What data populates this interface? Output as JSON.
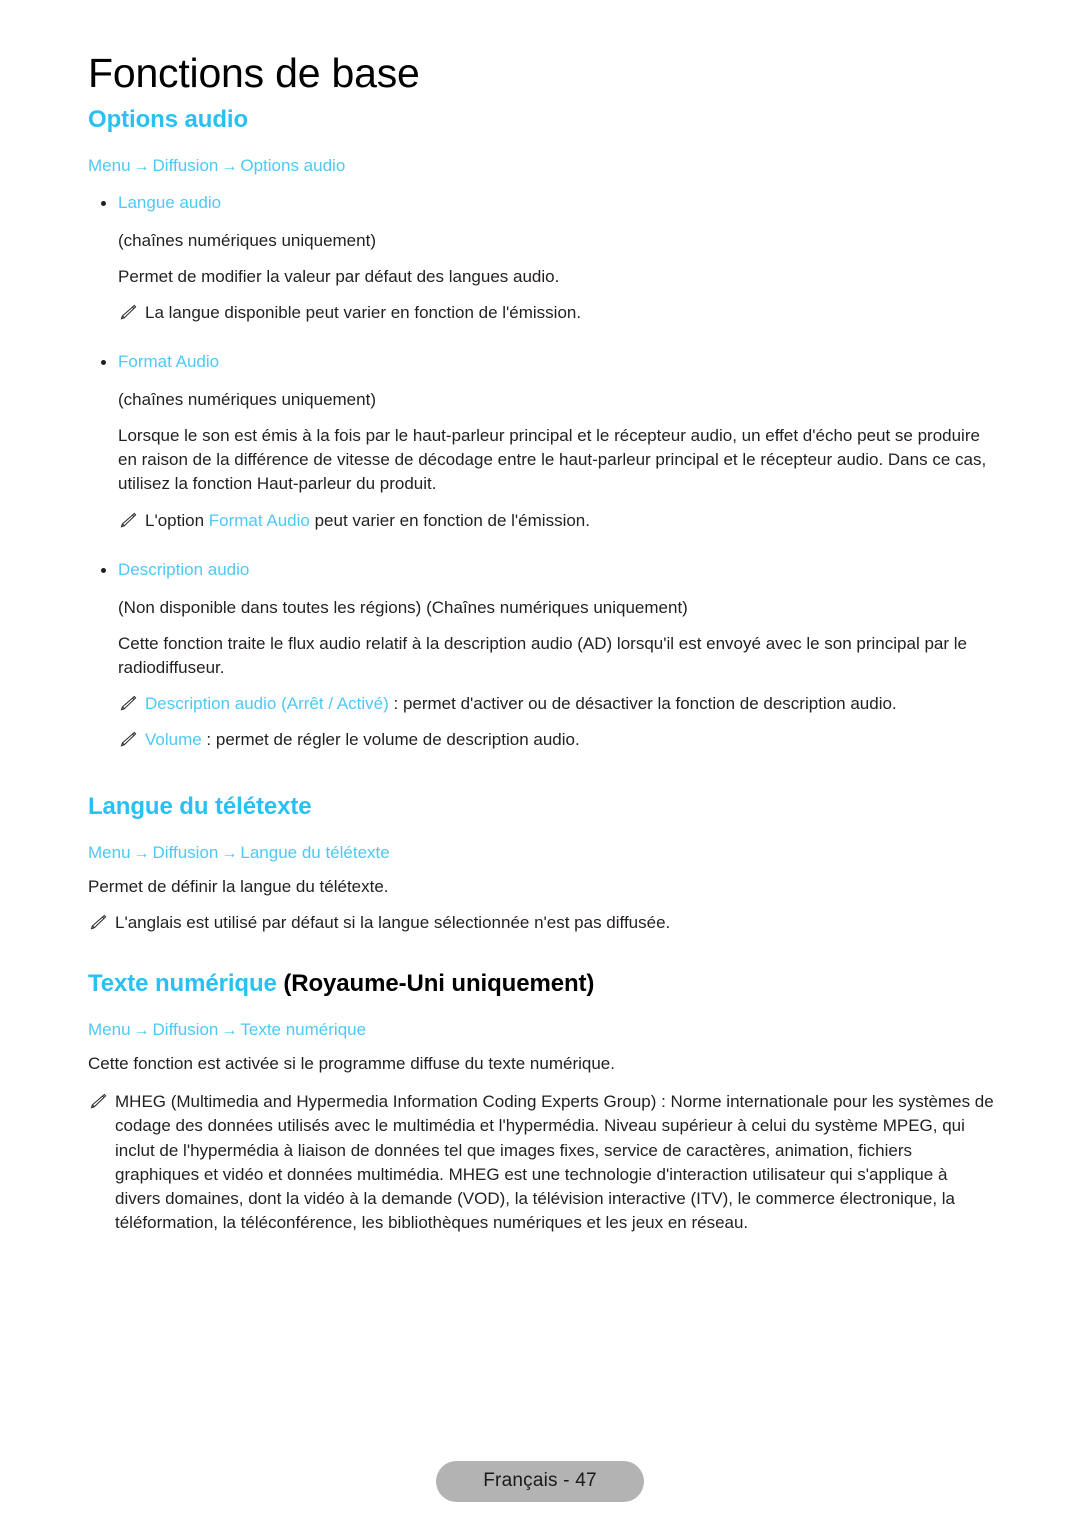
{
  "document": {
    "chapter_title": "Fonctions de base",
    "footer_label": "Français - 47",
    "accent_color": "#29c1f4",
    "link_color": "#4cc9f7",
    "text_color": "#231f20",
    "note_icon": "pencil-icon",
    "bullet_icon": "bullet-dot-icon",
    "arrow_glyph": "→"
  },
  "sections": {
    "options_audio": {
      "heading": "Options audio",
      "breadcrumb": {
        "item1": "Menu",
        "item2": "Diffusion",
        "item3": "Options audio"
      },
      "items": {
        "langue_audio": {
          "bullet_label": "Langue audio",
          "subtitle": "(chaînes numériques uniquement)",
          "body": "Permet de modifier la valeur par défaut des langues audio.",
          "note": "La langue disponible peut varier en fonction de l'émission."
        },
        "format_audio": {
          "bullet_label": "Format Audio",
          "subtitle": "(chaînes numériques uniquement)",
          "body": "Lorsque le son est émis à la fois par le haut-parleur principal et le récepteur audio, un effet d'écho peut se produire en raison de la différence de vitesse de décodage entre le haut-parleur principal et le récepteur audio. Dans ce cas, utilisez la fonction Haut-parleur du produit.",
          "note_prefix": "L'option ",
          "note_link": "Format Audio",
          "note_suffix": " peut varier en fonction de l'émission."
        },
        "description_audio": {
          "bullet_label": "Description audio",
          "subtitle": "(Non disponible dans toutes les régions) (Chaînes numériques uniquement)",
          "body": "Cette fonction traite le flux audio relatif à la description audio (AD) lorsqu'il est envoyé avec le son principal par le radiodiffuseur.",
          "note1_link": "Description audio",
          "note1_options": "(Arrêt / Activé)",
          "note1_suffix": " : permet d'activer ou de désactiver la fonction de description audio.",
          "note2_link": "Volume",
          "note2_suffix": " : permet de régler le volume de description audio."
        }
      }
    },
    "langue_teletexte": {
      "heading": "Langue du télétexte",
      "breadcrumb": {
        "item1": "Menu",
        "item2": "Diffusion",
        "item3": "Langue du télétexte"
      },
      "body": "Permet de définir la langue du télétexte.",
      "note": "L'anglais est utilisé par défaut si la langue sélectionnée n'est pas diffusée."
    },
    "texte_numerique": {
      "heading_accent": "Texte numérique",
      "heading_black": " (Royaume-Uni uniquement)",
      "breadcrumb": {
        "item1": "Menu",
        "item2": "Diffusion",
        "item3": "Texte numérique"
      },
      "body": "Cette fonction est activée si le programme diffuse du texte numérique.",
      "note": "MHEG (Multimedia and Hypermedia Information Coding Experts Group) : Norme internationale pour les systèmes de codage des données utilisés avec le multimédia et l'hypermédia. Niveau supérieur à celui du système MPEG, qui inclut de l'hypermédia à liaison de données tel que images fixes, service de caractères, animation, fichiers graphiques et vidéo et données multimédia. MHEG est une technologie d'interaction utilisateur qui s'applique à divers domaines, dont la vidéo à la demande (VOD), la télévision interactive (ITV), le commerce électronique, la téléformation, la téléconférence, les bibliothèques numériques et les jeux en réseau."
    }
  }
}
